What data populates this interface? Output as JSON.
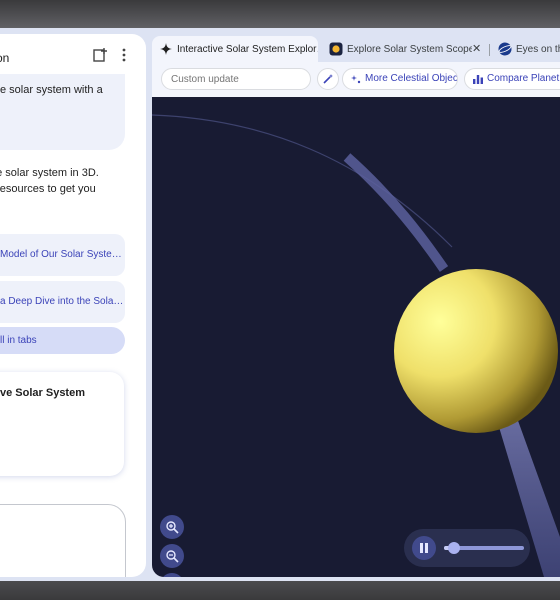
{
  "side_panel": {
    "title": "on",
    "user_message": "e solar system with a",
    "reply_lines": [
      "he solar system in 3D.",
      "t resources to get you"
    ],
    "link_cards": [
      {
        "label": " Model of Our Solar Syste…"
      },
      {
        "label": "a Deep Dive into the Sola…"
      }
    ],
    "open_tabs_label": "ll in tabs",
    "canvas_card_title": "ve Solar System"
  },
  "tabs": [
    {
      "label": "Interactive Solar System Explor…",
      "icon": "sparkle-icon",
      "active": true
    },
    {
      "label": "Explore Solar System Scope -",
      "icon": "solar-system-scope-icon",
      "active": false
    },
    {
      "label": "Eyes on the",
      "icon": "nasa-eyes-icon",
      "active": false
    }
  ],
  "toolbar": {
    "custom_update_placeholder": "Custom update",
    "chips": [
      {
        "label": "More Celestial Objects",
        "icon": "stars-icon"
      },
      {
        "label": "Compare Planet Sta",
        "icon": "bar-chart-icon"
      }
    ]
  },
  "player": {
    "progress": 0.12
  },
  "colors": {
    "accent": "#3b43b8",
    "space": "#181b33",
    "planet": "#f6e27a"
  }
}
